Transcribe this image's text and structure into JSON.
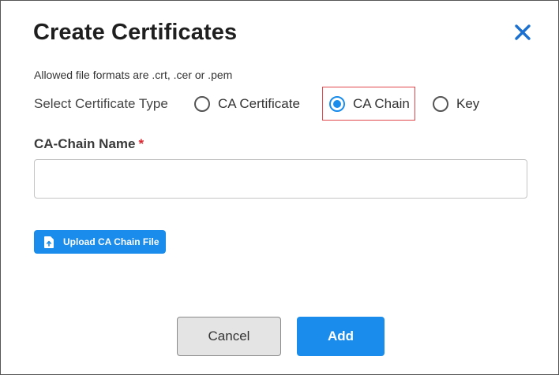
{
  "dialog": {
    "title": "Create Certificates",
    "formats_note": "Allowed file formats are .crt, .cer or .pem"
  },
  "certificate_type": {
    "label": "Select Certificate Type",
    "options": [
      {
        "label": "CA Certificate",
        "selected": false
      },
      {
        "label": "CA Chain",
        "selected": true
      },
      {
        "label": "Key",
        "selected": false
      }
    ]
  },
  "name_field": {
    "label": "CA-Chain Name",
    "required_marker": "*",
    "value": "",
    "placeholder": ""
  },
  "upload": {
    "label": "Upload CA Chain File",
    "icon": "file-upload-icon"
  },
  "actions": {
    "cancel_label": "Cancel",
    "add_label": "Add"
  },
  "colors": {
    "accent": "#1a8ceb",
    "highlight_border": "#e0474c",
    "required": "#d9262e"
  }
}
